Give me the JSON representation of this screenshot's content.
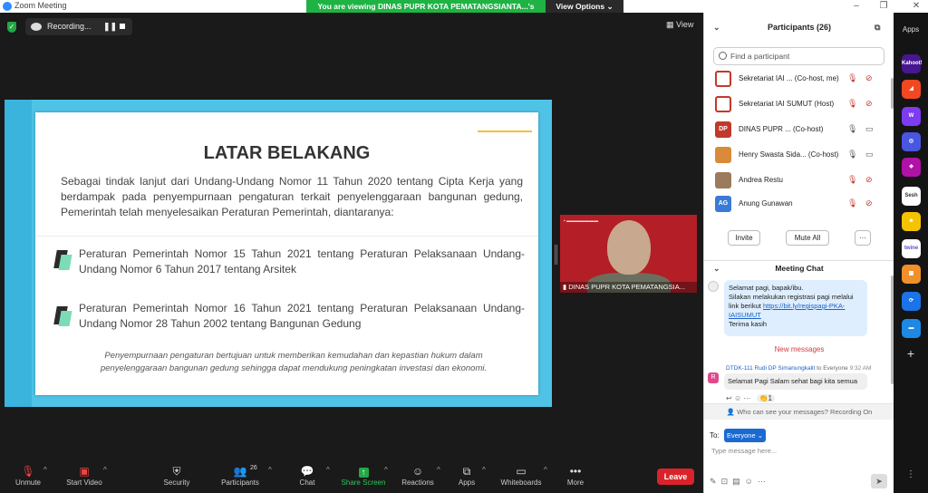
{
  "window": {
    "title": "Zoom Meeting"
  },
  "share_banner": {
    "message": "You are viewing DINAS PUPR KOTA PEMATANGSIANTA...'s screen",
    "view_options": "View Options"
  },
  "recording": {
    "label": "Recording..."
  },
  "view_label": "View",
  "slide": {
    "title": "LATAR BELAKANG",
    "intro": "Sebagai tindak lanjut dari Undang-Undang Nomor 11 Tahun 2020 tentang Cipta Kerja yang berdampak pada penyempurnaan pengaturan terkait penyelenggaraan bangunan gedung, Pemerintah telah menyelesaikan Peraturan Pemerintah, diantaranya:",
    "bullets": [
      "Peraturan Pemerintah Nomor 15 Tahun 2021 tentang Peraturan Pelaksanaan Undang-Undang Nomor 6 Tahun 2017 tentang Arsitek",
      "Peraturan Pemerintah Nomor 16 Tahun 2021 tentang Peraturan Pelaksanaan Undang-Undang Nomor 28 Tahun 2002 tentang Bangunan Gedung"
    ],
    "note": "Penyempurnaan pengaturan bertujuan untuk memberikan kemudahan dan kepastian hukum dalam penyelenggaraan bangunan gedung sehingga dapat mendukung peningkatan investasi dan ekonomi."
  },
  "camera": {
    "name": "DINAS PUPR KOTA PEMATANGSIA..."
  },
  "toolbar": {
    "unmute": "Unmute",
    "start_video": "Start Video",
    "security": "Security",
    "participants": "Participants",
    "participants_count": "26",
    "chat": "Chat",
    "share_screen": "Share Screen",
    "reactions": "Reactions",
    "apps": "Apps",
    "whiteboards": "Whiteboards",
    "more": "More",
    "leave": "Leave"
  },
  "participants_panel": {
    "title": "Participants (26)",
    "search_placeholder": "Find a participant",
    "rows": [
      {
        "initials": "",
        "name": "Sekretariat IAI ... (Co-host, me)"
      },
      {
        "initials": "",
        "name": "Sekretariat IAI SUMUT (Host)"
      },
      {
        "initials": "DP",
        "name": "DINAS PUPR ... (Co-host)"
      },
      {
        "initials": "",
        "name": "Henry Swasta Sida... (Co-host)"
      },
      {
        "initials": "",
        "name": "Andrea Restu"
      },
      {
        "initials": "AG",
        "name": "Anung Gunawan"
      }
    ],
    "invite": "Invite",
    "mute_all": "Mute All",
    "more": "···"
  },
  "chat": {
    "title": "Meeting Chat",
    "msg1_line1": "Selamat pagi, bapak/ibu.",
    "msg1_line2": "Silakan melakukan registrasi pagi melalui link berikut",
    "msg1_link": "https://bit.ly/regispagi-PKA-IAISUMUT",
    "msg1_line3": "Terima kasih",
    "new_messages": "New messages",
    "msg2_sender": "DTDK-111 Rudi DP Simanungkalit",
    "msg2_to": "to Everyone",
    "msg2_time": "9:32 AM",
    "msg2_text": "Selamat Pagi Salam sehat bagi kita semua",
    "reaction_count": "1",
    "who_can_see": "Who can see your messages? Recording On",
    "to_label": "To:",
    "everyone": "Everyone",
    "placeholder": "Type message here..."
  },
  "apps_bar": {
    "label": "Apps",
    "apps": [
      "Kahoot!",
      "",
      "",
      "",
      "",
      "Sesh",
      "",
      "twine",
      "",
      "",
      ""
    ]
  }
}
